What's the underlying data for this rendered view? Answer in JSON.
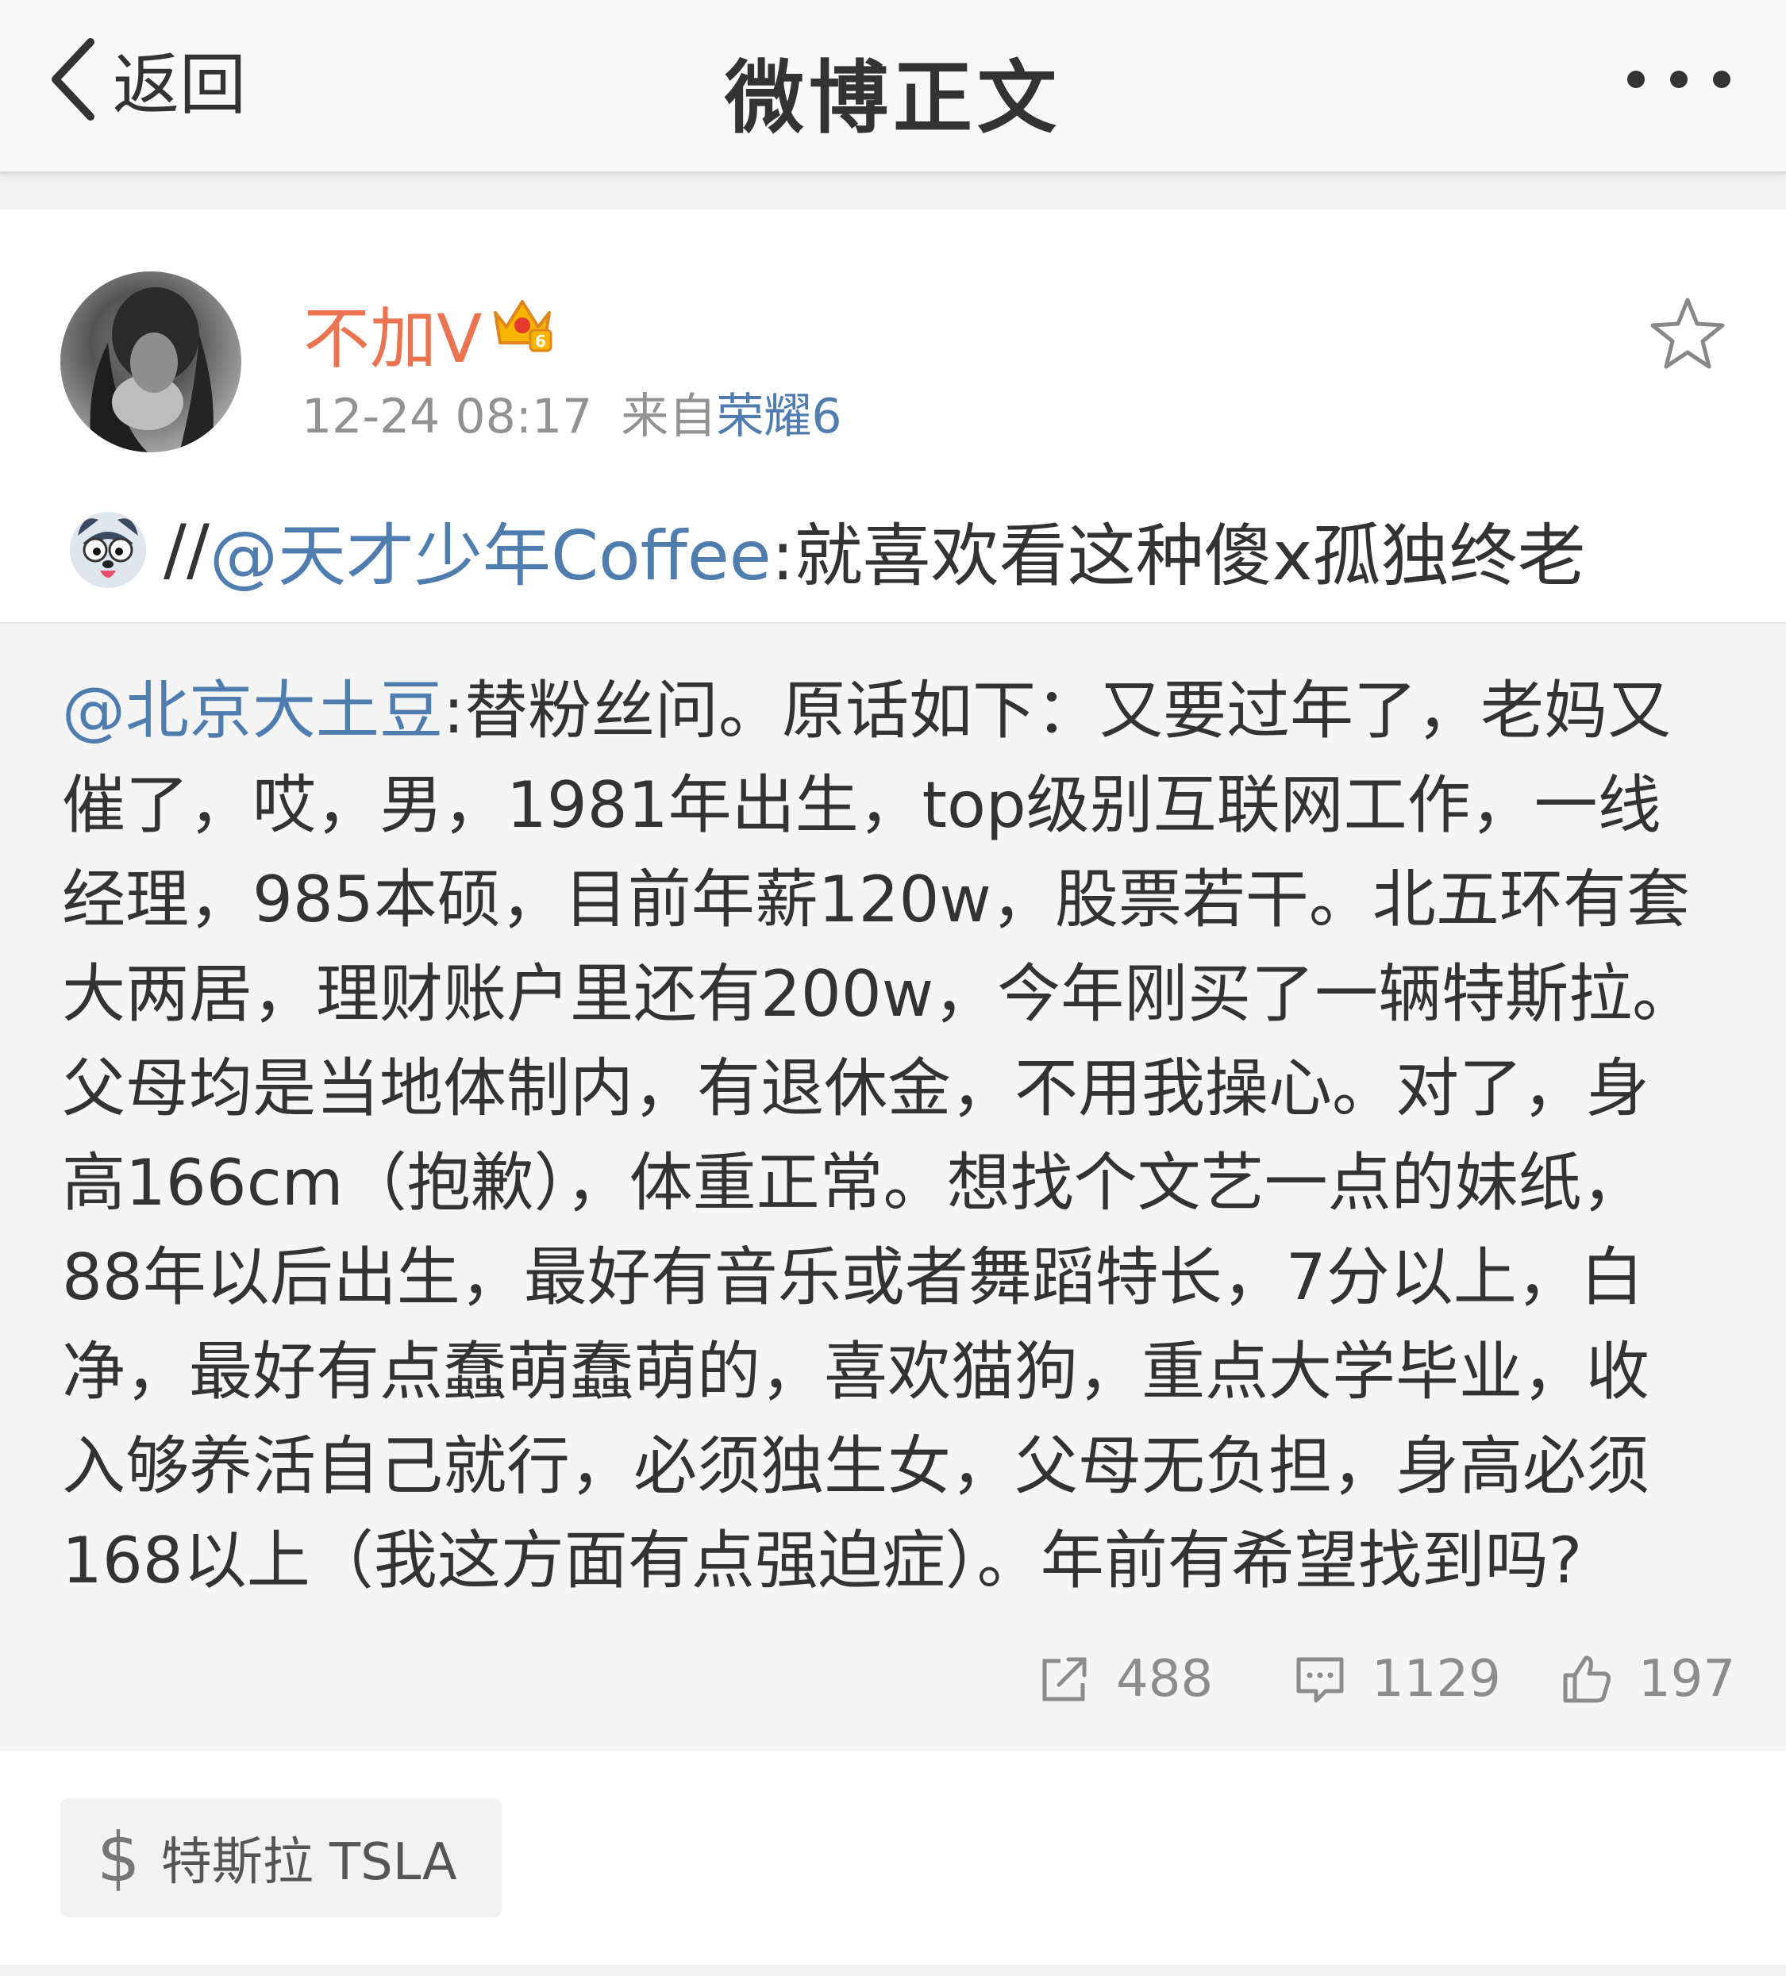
{
  "nav": {
    "back_label": "返回",
    "title": "微博正文"
  },
  "post": {
    "username": "不加V",
    "timestamp": "12-24 08:17",
    "source_prefix": "来自",
    "source_device": "荣耀6",
    "emoji_icon": "dog-face-emoji",
    "repost_prefix": "//",
    "repost_mention": "@天才少年Coffee",
    "repost_text": ":就喜欢看这种傻x孤独终老"
  },
  "original": {
    "mention": "@北京大土豆",
    "lines": [
      ":替粉丝问。原话如下：又要过年了，老妈又",
      "催了，哎，男，1981年出生，top级别互联网工作，一线",
      "经理，985本硕，目前年薪120w，股票若干。北五环有套",
      "大两居，理财账户里还有200w，今年刚买了一辆特斯拉。",
      "父母均是当地体制内，有退休金，不用我操心。对了，身",
      "高166cm（抱歉），体重正常。想找个文艺一点的妹纸，",
      "88年以后出生，最好有音乐或者舞蹈特长，7分以上，白",
      "净，最好有点蠢萌蠢萌的，喜欢猫狗，重点大学毕业，收",
      "入够养活自己就行，必须独生女，父母无负担，身高必须",
      "168以上（我这方面有点强迫症）。年前有希望找到吗?"
    ],
    "repost_count": "488",
    "comment_count": "1129",
    "like_count": "197"
  },
  "stock_tag": {
    "label": "特斯拉 TSLA",
    "icon": "dollar-icon"
  },
  "colors": {
    "link": "#507daf",
    "username": "#eb7350",
    "muted": "#929292"
  }
}
